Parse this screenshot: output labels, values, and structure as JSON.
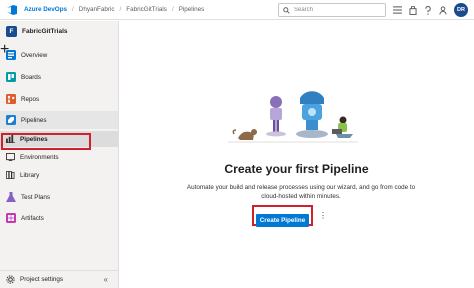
{
  "header": {
    "brand": "Azure DevOps",
    "breadcrumbs": [
      "DhyanFabric",
      "FabricGitTrials",
      "Pipelines"
    ],
    "search_placeholder": "Search",
    "avatar_initials": "DR"
  },
  "sidebar": {
    "project_initial": "F",
    "project_name": "FabricGitTrials",
    "add_symbol": "+",
    "items": [
      {
        "label": "Overview"
      },
      {
        "label": "Boards"
      },
      {
        "label": "Repos"
      },
      {
        "label": "Pipelines"
      },
      {
        "label": "Pipelines"
      },
      {
        "label": "Environments"
      },
      {
        "label": "Library"
      },
      {
        "label": "Test Plans"
      },
      {
        "label": "Artifacts"
      }
    ],
    "footer_label": "Project settings",
    "collapse_symbol": "«"
  },
  "main": {
    "title": "Create your first Pipeline",
    "description": "Automate your build and release processes using our wizard, and go from code to cloud-hosted within minutes.",
    "button_label": "Create Pipeline",
    "more_symbol": "⋮"
  },
  "colors": {
    "accent": "#0078d4",
    "highlight": "#d1202d",
    "sidebar_bg": "#f3f2f1",
    "project_badge": "#1b4b8f"
  }
}
